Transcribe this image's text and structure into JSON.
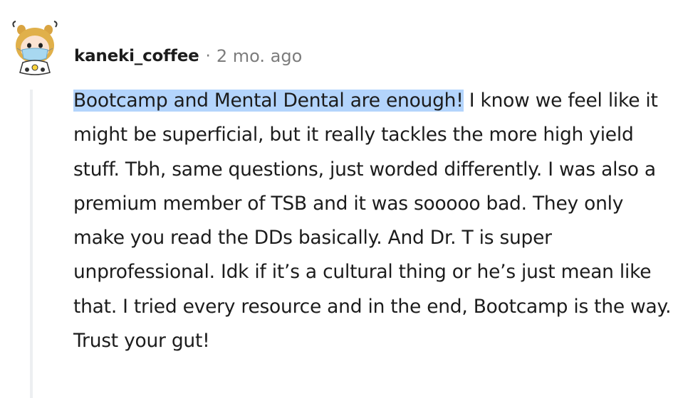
{
  "comment": {
    "username": "kaneki_coffee",
    "separator": "·",
    "timestamp": "2 mo. ago",
    "avatar_icon": "snoo-avatar-with-mask-icon",
    "highlighted_text": "Bootcamp and Mental Dental are enough!",
    "body_text": " I know we feel like it might be superficial, but it really tackles the more high yield stuff. Tbh, same questions, just worded differently. I was also a premium member of TSB and it was sooooo bad. They only make you read the DDs basically. And Dr. T is super unprofessional. Idk if it’s a cultural thing or he’s just mean like that. I tried every resource and in the end, Bootcamp is the way. Trust your gut!"
  },
  "colors": {
    "highlight": "#b3d4fc",
    "thread_line": "#edeff1",
    "meta_text": "#7c7c7c",
    "body_text": "#1c1c1c"
  }
}
